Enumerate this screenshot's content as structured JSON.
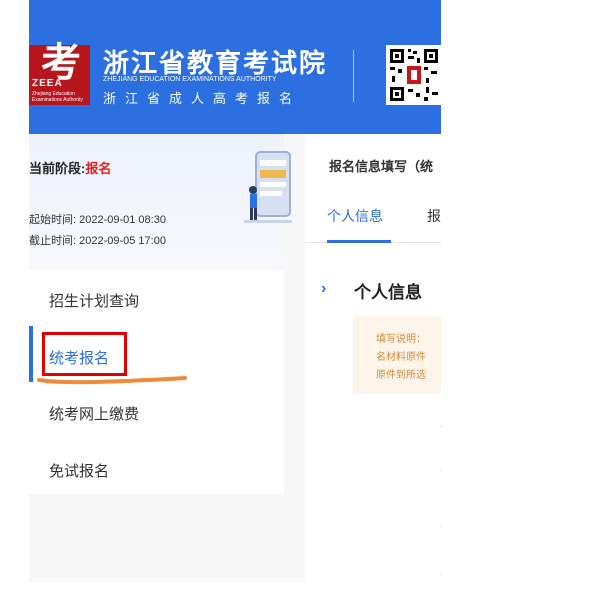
{
  "header": {
    "logo_glyph": "考",
    "logo_abbr": "ZEEA",
    "logo_small_text": "Zhejiang Education Examinations Authority",
    "title": "浙江省教育考试院",
    "subtitle_en": "ZHEJIANG EDUCATION EXAMINATIONS AUTHORITY",
    "subtitle_cn": "浙江省成人高考报名"
  },
  "stage": {
    "label": "当前阶段:",
    "value": "报名",
    "start_time": "起始时间: 2022-09-01 08:30",
    "end_time": "截止时间: 2022-09-05 17:00"
  },
  "menu": {
    "items": [
      {
        "label": "招生计划查询"
      },
      {
        "label": "统考报名"
      },
      {
        "label": "统考网上缴费"
      },
      {
        "label": "免试报名"
      }
    ]
  },
  "main": {
    "breadcrumb": "报名信息填写（统",
    "tabs": [
      {
        "label": "个人信息"
      },
      {
        "label": "报"
      }
    ],
    "section_arrow": "›",
    "section_title": "个人信息",
    "notice_lines": [
      "填写说明：",
      "名材料原件",
      "原件到所选"
    ]
  },
  "colors": {
    "brand_blue": "#2b6fe0",
    "logo_red": "#b8161d",
    "stage_red": "#e02020",
    "notice_bg": "#fdf5ea",
    "annotation_red": "#e00000",
    "annotation_orange": "#f08a3c"
  }
}
